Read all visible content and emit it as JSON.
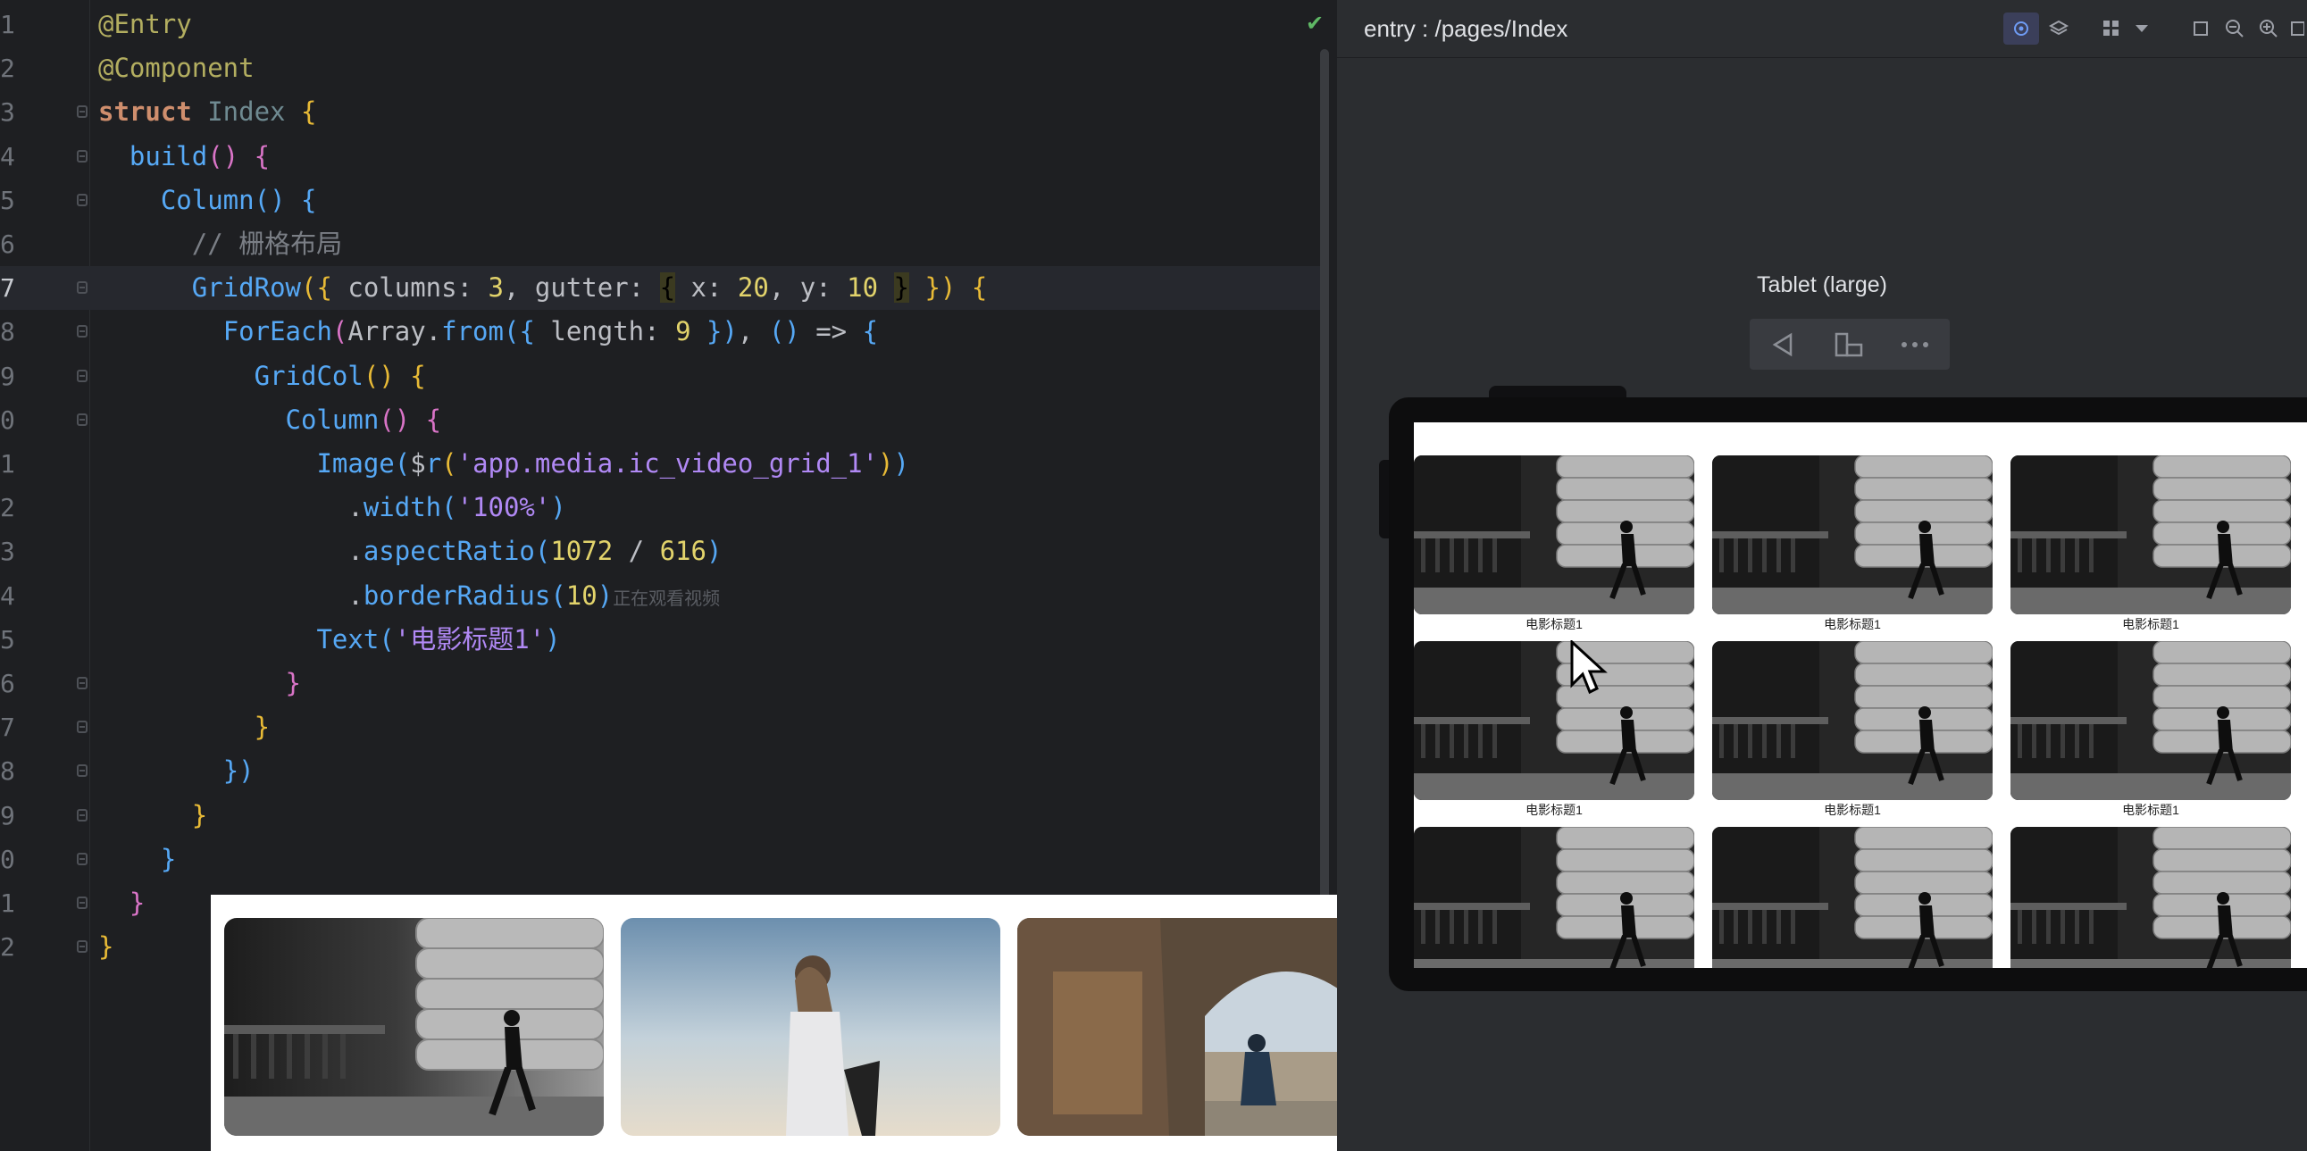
{
  "editor": {
    "lines": [
      {
        "n": "1",
        "tokens": [
          [
            "ann",
            "@Entry"
          ]
        ]
      },
      {
        "n": "2",
        "tokens": [
          [
            "ann",
            "@Component"
          ]
        ]
      },
      {
        "n": "3",
        "tokens": [
          [
            "kw",
            "struct "
          ],
          [
            "cls",
            "Index "
          ],
          [
            "br1",
            "{"
          ]
        ]
      },
      {
        "n": "4",
        "tokens": [
          [
            "pun",
            "  "
          ],
          [
            "fn",
            "build"
          ],
          [
            "br2",
            "() "
          ],
          [
            "br2",
            "{"
          ]
        ]
      },
      {
        "n": "5",
        "tokens": [
          [
            "pun",
            "    "
          ],
          [
            "call",
            "Column"
          ],
          [
            "br3",
            "() "
          ],
          [
            "br3",
            "{"
          ]
        ]
      },
      {
        "n": "6",
        "tokens": [
          [
            "pun",
            "      "
          ],
          [
            "cmt",
            "// 栅格布局"
          ]
        ]
      },
      {
        "n": "7",
        "tokens": [
          [
            "pun",
            "      "
          ],
          [
            "call",
            "GridRow"
          ],
          [
            "br1",
            "({ "
          ],
          [
            "key",
            "columns: "
          ],
          [
            "num",
            "3"
          ],
          [
            "pun",
            ", "
          ],
          [
            "key",
            "gutter: "
          ],
          [
            "hl",
            "{"
          ],
          [
            "key",
            " x: "
          ],
          [
            "num",
            "20"
          ],
          [
            "pun",
            ", "
          ],
          [
            "key",
            "y: "
          ],
          [
            "num",
            "10 "
          ],
          [
            "hl",
            "}"
          ],
          [
            "br1",
            " }) "
          ],
          [
            "br1",
            "{"
          ]
        ]
      },
      {
        "n": "8",
        "tokens": [
          [
            "pun",
            "        "
          ],
          [
            "call",
            "ForEach"
          ],
          [
            "br2",
            "("
          ],
          [
            "pun",
            "Array."
          ],
          [
            "call",
            "from"
          ],
          [
            "br3",
            "({ "
          ],
          [
            "key",
            "length: "
          ],
          [
            "num",
            "9 "
          ],
          [
            "br3",
            "})"
          ],
          [
            "pun",
            ", "
          ],
          [
            "br3",
            "() "
          ],
          [
            "pun",
            "=> "
          ],
          [
            "br3",
            "{"
          ]
        ]
      },
      {
        "n": "9",
        "tokens": [
          [
            "pun",
            "          "
          ],
          [
            "call",
            "GridCol"
          ],
          [
            "br1",
            "() "
          ],
          [
            "br1",
            "{"
          ]
        ]
      },
      {
        "n": "0",
        "tokens": [
          [
            "pun",
            "            "
          ],
          [
            "call",
            "Column"
          ],
          [
            "br2",
            "() "
          ],
          [
            "br2",
            "{"
          ]
        ]
      },
      {
        "n": "1",
        "tokens": [
          [
            "pun",
            "              "
          ],
          [
            "call",
            "Image"
          ],
          [
            "br3",
            "("
          ],
          [
            "pun",
            "$"
          ],
          [
            "call",
            "r"
          ],
          [
            "br1",
            "("
          ],
          [
            "str",
            "'app.media.ic_video_grid_1'"
          ],
          [
            "br1",
            ")"
          ],
          [
            "br3",
            ")"
          ]
        ]
      },
      {
        "n": "2",
        "tokens": [
          [
            "pun",
            "                ."
          ],
          [
            "call",
            "width"
          ],
          [
            "br3",
            "("
          ],
          [
            "str",
            "'100%'"
          ],
          [
            "br3",
            ")"
          ]
        ]
      },
      {
        "n": "3",
        "tokens": [
          [
            "pun",
            "                ."
          ],
          [
            "call",
            "aspectRatio"
          ],
          [
            "br3",
            "("
          ],
          [
            "num",
            "1072 "
          ],
          [
            "pun",
            "/ "
          ],
          [
            "num",
            "616"
          ],
          [
            "br3",
            ")"
          ]
        ]
      },
      {
        "n": "4",
        "tokens": [
          [
            "pun",
            "                ."
          ],
          [
            "call",
            "borderRadius"
          ],
          [
            "br3",
            "("
          ],
          [
            "num",
            "10"
          ],
          [
            "br3",
            ")"
          ],
          [
            "ghost",
            "正在观看视频"
          ]
        ]
      },
      {
        "n": "5",
        "tokens": [
          [
            "pun",
            "              "
          ],
          [
            "call",
            "Text"
          ],
          [
            "br3",
            "("
          ],
          [
            "str",
            "'电影标题1'"
          ],
          [
            "br3",
            ")"
          ]
        ]
      },
      {
        "n": "6",
        "tokens": [
          [
            "pun",
            "            "
          ],
          [
            "br2",
            "}"
          ]
        ]
      },
      {
        "n": "7",
        "tokens": [
          [
            "pun",
            "          "
          ],
          [
            "br1",
            "}"
          ]
        ]
      },
      {
        "n": "8",
        "tokens": [
          [
            "pun",
            "        "
          ],
          [
            "br3",
            "})"
          ]
        ]
      },
      {
        "n": "9",
        "tokens": [
          [
            "pun",
            "      "
          ],
          [
            "br1",
            "}"
          ]
        ]
      },
      {
        "n": "0",
        "tokens": [
          [
            "pun",
            "    "
          ],
          [
            "br3",
            "}"
          ]
        ]
      },
      {
        "n": "1",
        "tokens": [
          [
            "pun",
            "  "
          ],
          [
            "br2",
            "}"
          ]
        ]
      },
      {
        "n": "2",
        "tokens": [
          [
            "br1",
            "}"
          ]
        ]
      }
    ],
    "current_line_index": 6
  },
  "previewer": {
    "route": "entry : /pages/Index",
    "device_label": "Tablet (large)",
    "caption": "电影标题1",
    "tile_count": 9
  },
  "icons": {
    "check": "check-icon",
    "inspect": "inspect-icon",
    "layers": "layers-icon",
    "grid": "grid-icon",
    "dropdown": "chevron-down-icon",
    "crop": "crop-icon",
    "zoom_out": "zoom-out-icon",
    "zoom_in": "zoom-in-icon",
    "back": "back-icon",
    "rotate": "rotate-icon",
    "more": "more-icon",
    "cursor": "mouse-cursor-icon"
  },
  "colors": {
    "editor_bg": "#1e1f22",
    "panel_bg": "#2b2d30",
    "accent": "#3574f0"
  }
}
